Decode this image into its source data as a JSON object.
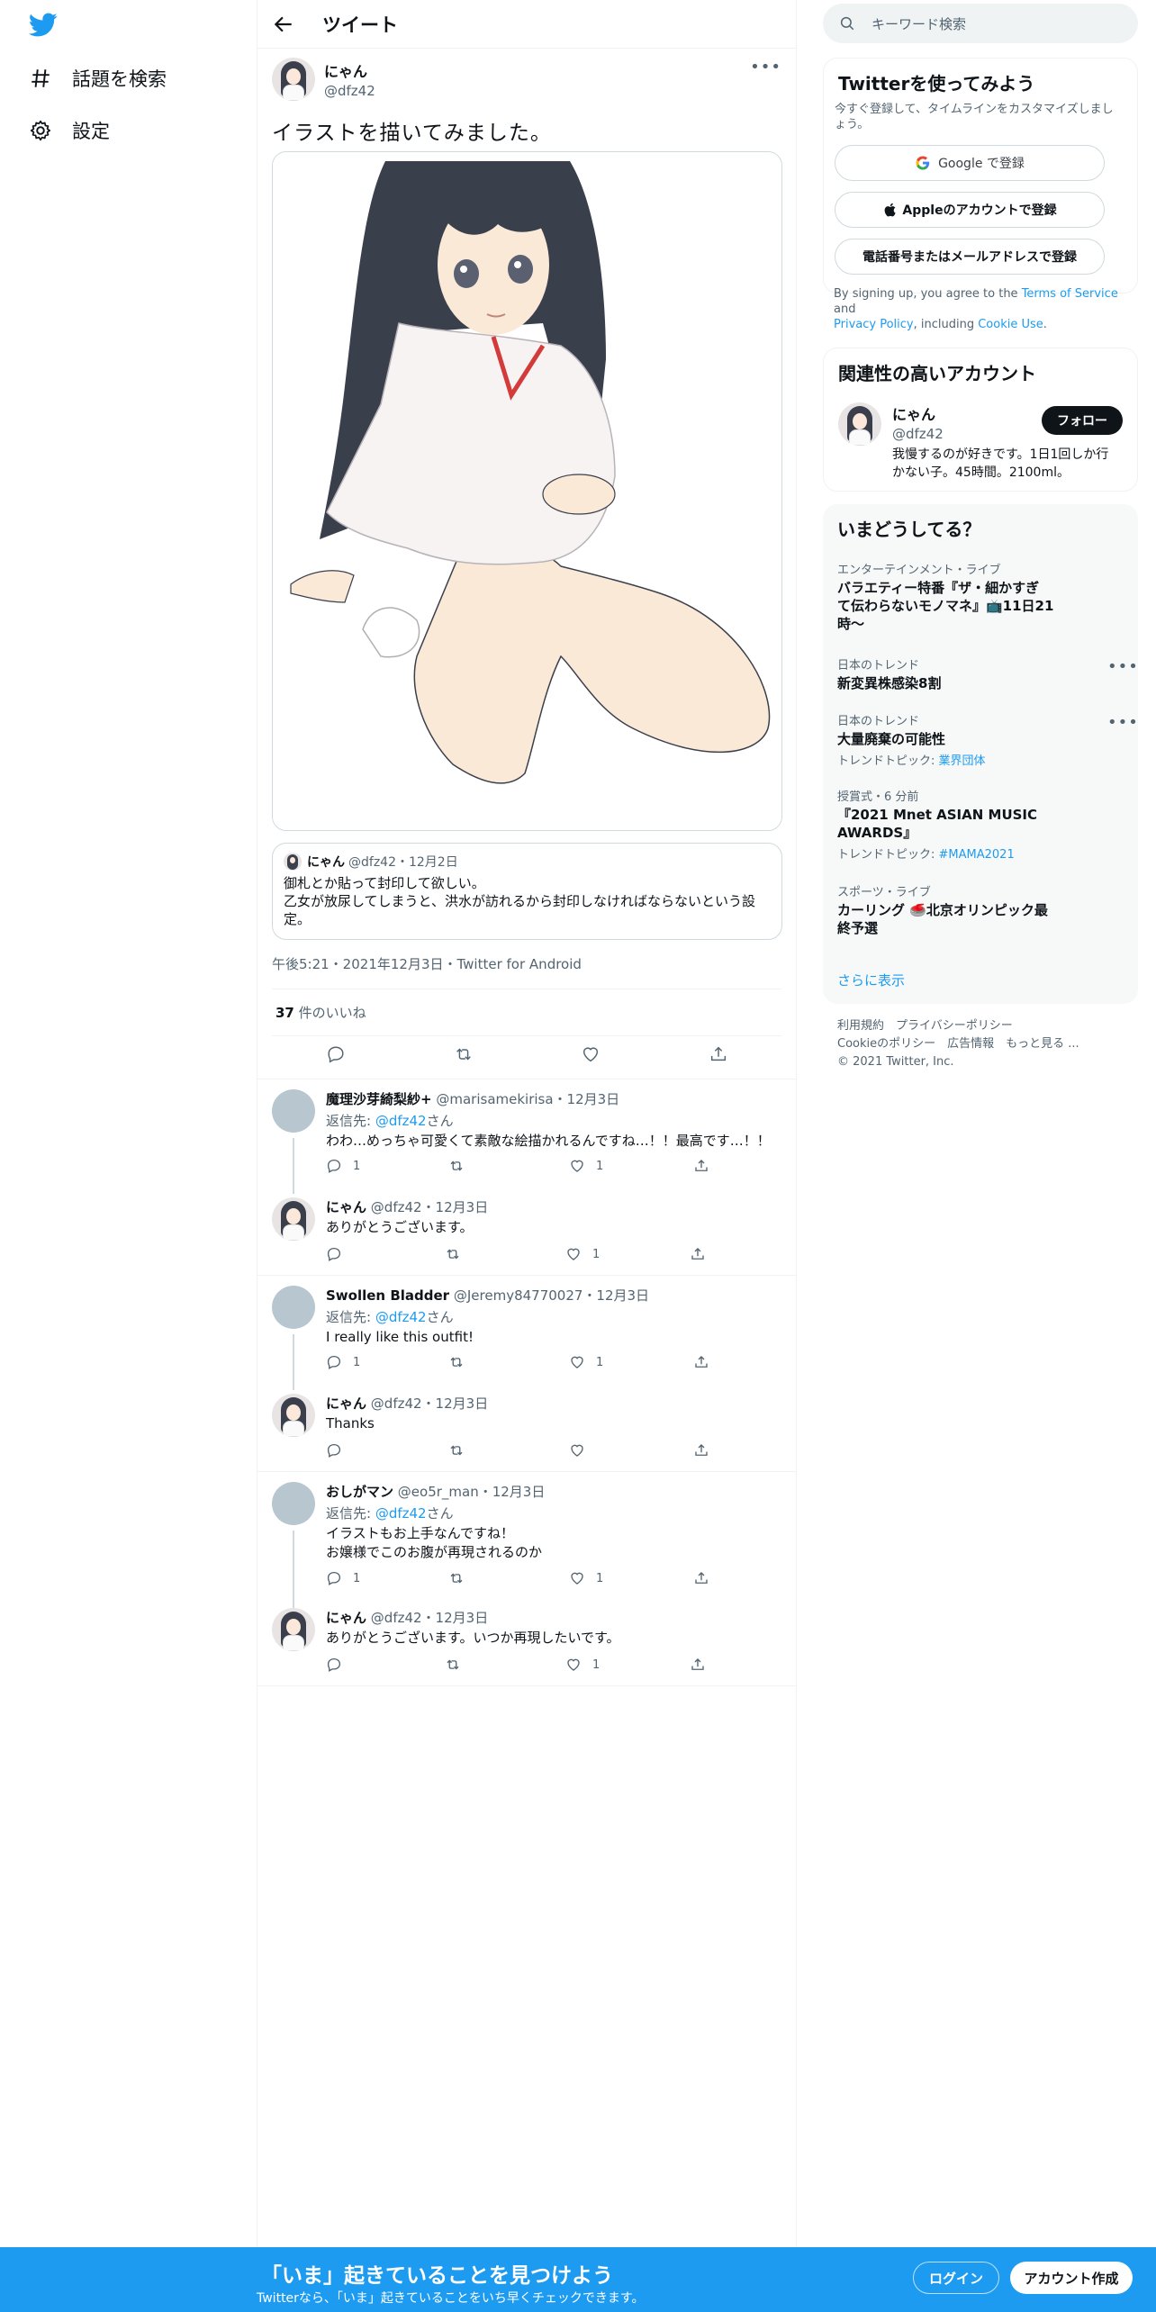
{
  "nav": {
    "logo": "twitter-bird-icon",
    "items": [
      {
        "icon": "hashtag-icon",
        "label": "話題を検索"
      },
      {
        "icon": "gear-icon",
        "label": "設定"
      }
    ]
  },
  "header": {
    "title": "ツイート"
  },
  "tweet": {
    "name": "にゃん",
    "handle": "@dfz42",
    "text": "イラストを描いてみました。",
    "meta": "午後5:21・2021年12月3日・Twitter for Android",
    "likes_count": "37",
    "likes_label": "件のいいね",
    "quote": {
      "name": "にゃん",
      "handle_date": "@dfz42・12月2日",
      "line1": "御札とか貼って封印して欲しい。",
      "line2": "乙女が放尿してしまうと、洪水が訪れるから封印しなければならないという設",
      "line3": "定。"
    }
  },
  "replies": [
    {
      "name": "魔理沙芽綺梨紗+",
      "meta": "@marisamekirisa・12月3日",
      "to_prefix": "返信先: ",
      "to": "@dfz42",
      "to_suffix": "さん",
      "text1": "わわ…めっちゃ可愛くて素敵な絵描かれるんですね…！！最高です…！！",
      "text2": "",
      "replies": "1",
      "likes": "1"
    },
    {
      "name": "にゃん",
      "meta": "@dfz42・12月3日",
      "text1": "ありがとうございます。",
      "likes": "1"
    },
    {
      "name": "Swollen Bladder",
      "meta": "@Jeremy84770027・12月3日",
      "to_prefix": "返信先: ",
      "to": "@dfz42",
      "to_suffix": "さん",
      "text1": "I really like this outfit!",
      "replies": "1",
      "likes": "1"
    },
    {
      "name": "にゃん",
      "meta": "@dfz42・12月3日",
      "text1": "Thanks"
    },
    {
      "name": "おしがマン",
      "meta": "@eo5r_man・12月3日",
      "to_prefix": "返信先: ",
      "to": "@dfz42",
      "to_suffix": "さん",
      "text1": "イラストもお上手なんですね！",
      "text2": "お嬢様でこのお腹が再現されるのか",
      "replies": "1",
      "likes": "1"
    },
    {
      "name": "にゃん",
      "meta": "@dfz42・12月3日",
      "text1": "ありがとうございます。いつか再現したいです。",
      "likes": "1"
    }
  ],
  "search": {
    "placeholder": "キーワード検索"
  },
  "signup": {
    "title": "Twitterを使ってみよう",
    "subtitle1": "今すぐ登録して、タイムラインをカスタマイズしまし",
    "subtitle2": "ょう。",
    "google": "Google で登録",
    "apple": "Appleのアカウントで登録",
    "phone": "電話番号またはメールアドレスで登録",
    "terms_a": "By signing up, you agree to the ",
    "terms_link1": "Terms of Service",
    "terms_b": " and",
    "terms_link2": "Privacy Policy",
    "terms_c": ", including ",
    "terms_link3": "Cookie Use",
    "terms_d": "."
  },
  "related": {
    "title": "関連性の高いアカウント",
    "name": "にゃん",
    "handle": "@dfz42",
    "follow": "フォロー",
    "bio1": "我慢するのが好きです。1日1回しか行",
    "bio2": "かない子。45時間。2100ml。"
  },
  "trends": {
    "title": "いまどうしてる？",
    "items": [
      {
        "cat": "エンターテインメント・ライブ",
        "name1": "バラエティー特番『ザ・細かすぎ",
        "name2": "て伝わらないモノマネ』📺11日21",
        "name3": "時〜"
      },
      {
        "cat": "日本のトレンド",
        "name1": "新変異株感染8割"
      },
      {
        "cat": "日本のトレンド",
        "name1": "大量廃棄の可能性",
        "sub_label": "トレンドトピック: ",
        "sub": "業界団体"
      },
      {
        "cat": "授賞式・6 分前",
        "name1": "『2021 Mnet ASIAN MUSIC",
        "name2": "AWARDS』",
        "sub_label": "トレンドトピック: ",
        "sub": "#MAMA2021"
      },
      {
        "cat": "スポーツ・ライブ",
        "name1": "カーリング 🥌北京オリンピック最",
        "name2": "終予選"
      }
    ],
    "show_more": "さらに表示"
  },
  "footer": {
    "line1": "利用規約　プライバシーポリシー",
    "line2": "Cookieのポリシー　広告情報　もっと見る ...",
    "line3": "© 2021 Twitter, Inc."
  },
  "bottom": {
    "title": "「いま」起きていることを見つけよう",
    "subtitle": "Twitterなら、「いま」起きていることをいち早くチェックできます。",
    "login": "ログイン",
    "signup": "アカウント作成"
  },
  "colors": {
    "accent": "#1d9bf0",
    "text": "#0f1419",
    "muted": "#536471"
  }
}
